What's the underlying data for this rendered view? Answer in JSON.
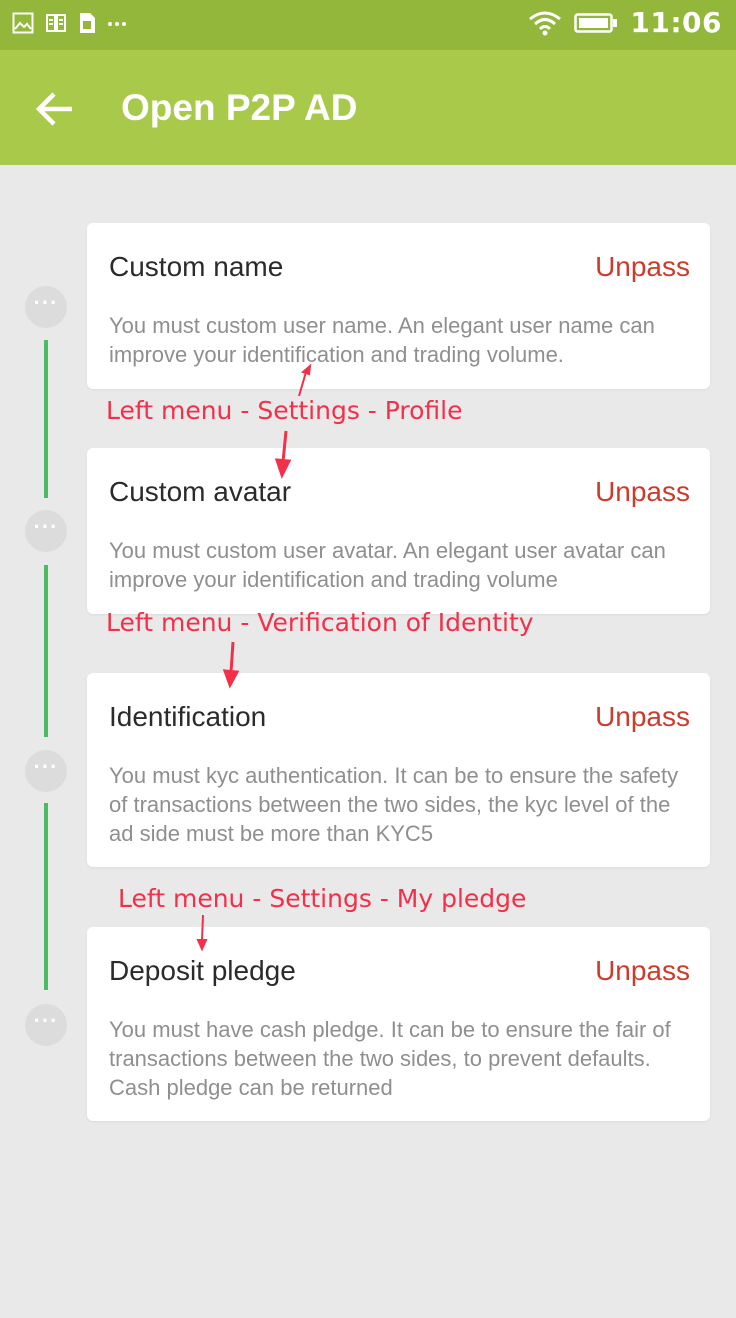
{
  "status_bar": {
    "time": "11:06",
    "left_icons": [
      "image-icon",
      "fan-icon",
      "sim-icon",
      "more-dots-icon"
    ],
    "right_icons": [
      "wifi-icon",
      "battery-icon"
    ]
  },
  "app_bar": {
    "title": "Open P2P AD",
    "back_icon": "arrow-left-icon"
  },
  "steps": [
    {
      "title": "Custom name",
      "status": "Unpass",
      "description": "You must custom user name. An elegant user name can improve your identification and trading volume."
    },
    {
      "title": "Custom avatar",
      "status": "Unpass",
      "description": "You must custom user avatar. An elegant user avatar can improve your identification and trading volume"
    },
    {
      "title": "Identification",
      "status": "Unpass",
      "description": "You must kyc authentication. It can be to ensure the safety of transactions between the two sides, the kyc level of the ad side must be more than KYC5"
    },
    {
      "title": "Deposit pledge",
      "status": "Unpass",
      "description": "You must have cash pledge. It can be to ensure the fair of transactions between the two sides, to prevent defaults. Cash pledge can be returned"
    }
  ],
  "annotations": [
    "Left menu - Settings - Profile",
    "Left menu - Verification of Identity",
    "Left menu - Settings - My pledge"
  ],
  "step_dot_glyph": "···",
  "colors": {
    "status_bar": "#92b73a",
    "app_bar": "#a8c94a",
    "background": "#e9e9e9",
    "timeline": "#4dbb62",
    "status_text": "#cc3b2b",
    "annotation": "#f2304a"
  }
}
